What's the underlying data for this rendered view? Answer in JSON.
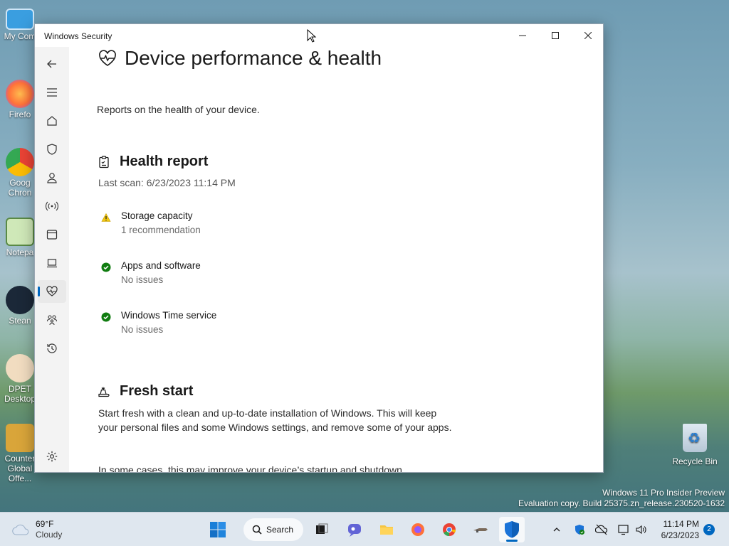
{
  "desktop": {
    "icons": [
      {
        "label": "My Com",
        "color": "#4fa3e0"
      },
      {
        "label": "Firefo",
        "color": "#f06b2b"
      },
      {
        "label": "Goog Chron",
        "color": "#e8453c"
      },
      {
        "label": "Notepa",
        "color": "#7bbf6a"
      },
      {
        "label": "Stean",
        "color": "#1b2838"
      },
      {
        "label": "DPET Desktop",
        "color": "#e8c9a0"
      },
      {
        "label": "Counter Global Offe...",
        "color": "#c9a23a"
      }
    ],
    "recycle_bin": "Recycle Bin",
    "watermark_line1": "Windows 11 Pro Insider Preview",
    "watermark_line2": "Evaluation copy. Build 25375.zn_release.230520-1632"
  },
  "window": {
    "title": "Windows Security",
    "min_icon": "minimize-icon",
    "max_icon": "maximize-icon",
    "close_icon": "close-icon"
  },
  "sidebar": {
    "items": [
      {
        "name": "back",
        "icon": "back-arrow-icon"
      },
      {
        "name": "menu",
        "icon": "hamburger-icon"
      },
      {
        "name": "home",
        "icon": "home-icon"
      },
      {
        "name": "virus-protection",
        "icon": "shield-icon"
      },
      {
        "name": "account-protection",
        "icon": "person-icon"
      },
      {
        "name": "firewall",
        "icon": "antenna-icon"
      },
      {
        "name": "app-browser-control",
        "icon": "browser-window-icon"
      },
      {
        "name": "device-security",
        "icon": "laptop-icon"
      },
      {
        "name": "device-performance",
        "icon": "heart-pulse-icon",
        "active": true
      },
      {
        "name": "family-options",
        "icon": "family-icon"
      },
      {
        "name": "protection-history",
        "icon": "history-icon"
      },
      {
        "name": "settings",
        "icon": "gear-icon"
      }
    ]
  },
  "page": {
    "title": "Device performance & health",
    "subtitle": "Reports on the health of your device.",
    "health_report": {
      "heading": "Health report",
      "last_scan": "Last scan: 6/23/2023 11:14 PM",
      "items": [
        {
          "name": "Storage capacity",
          "desc": "1 recommendation",
          "status": "warning"
        },
        {
          "name": "Apps and software",
          "desc": "No issues",
          "status": "ok"
        },
        {
          "name": "Windows Time service",
          "desc": "No issues",
          "status": "ok"
        }
      ]
    },
    "fresh_start": {
      "heading": "Fresh start",
      "para1": "Start fresh with a clean and up-to-date installation of Windows. This will keep your personal files and some Windows settings, and remove some of your apps.",
      "para2": "In some cases, this may improve your device’s startup and shutdown experience, memory usage, Store apps performance, browsing experience, and battery life."
    }
  },
  "colors": {
    "accent": "#0067c0",
    "ok": "#107c10",
    "warning": "#f2c811"
  },
  "taskbar": {
    "weather_temp": "69°F",
    "weather_desc": "Cloudy",
    "search_label": "Search",
    "clock_time": "11:14 PM",
    "clock_date": "6/23/2023",
    "notification_count": "2"
  }
}
